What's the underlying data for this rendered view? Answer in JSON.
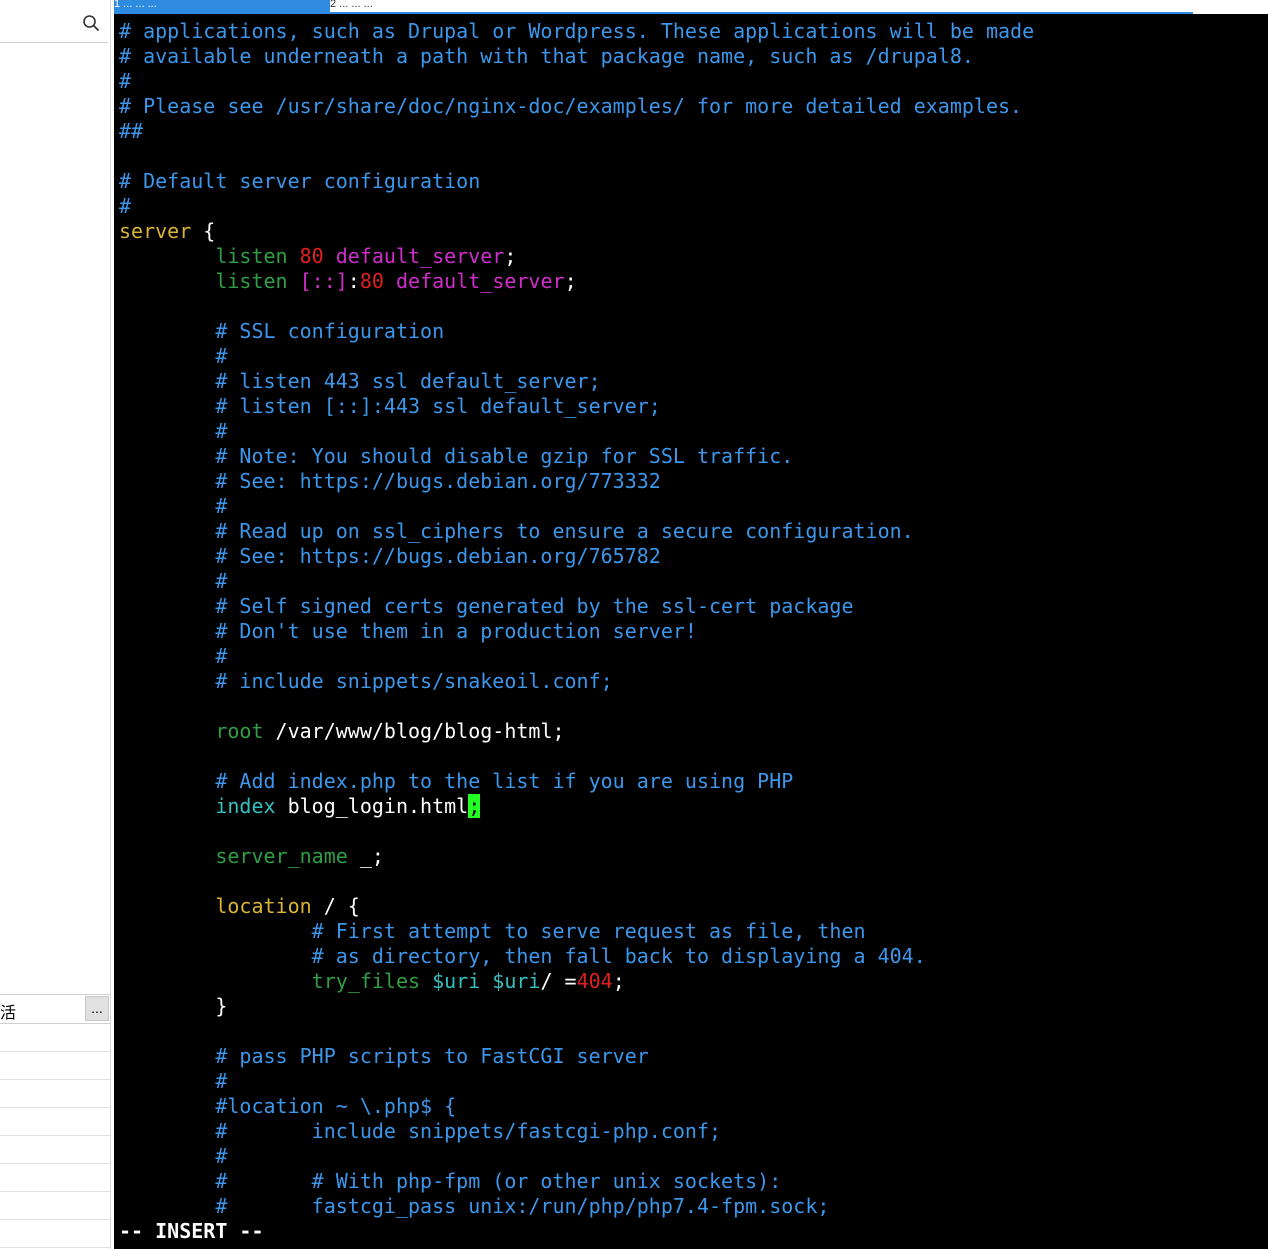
{
  "left_panel": {
    "bottom_row_label": "活",
    "more_button_label": "..."
  },
  "tabs": {
    "active": "1 ... ... ...",
    "inactive": "2 ... ... ..."
  },
  "editor": {
    "lines": [
      [
        {
          "t": "# applications, such as Drupal or Wordpress. These applications will be made",
          "c": "c"
        }
      ],
      [
        {
          "t": "# available underneath a path with that package name, such as /drupal8.",
          "c": "c"
        }
      ],
      [
        {
          "t": "#",
          "c": "c"
        }
      ],
      [
        {
          "t": "# Please see /usr/share/doc/nginx-doc/examples/ for more detailed examples.",
          "c": "c"
        }
      ],
      [
        {
          "t": "##",
          "c": "c"
        }
      ],
      [],
      [
        {
          "t": "# Default server configuration",
          "c": "c"
        }
      ],
      [
        {
          "t": "#",
          "c": "c"
        }
      ],
      [
        {
          "t": "server",
          "c": "kw"
        },
        {
          "t": " {",
          "c": "wt"
        }
      ],
      [
        {
          "t": "        ",
          "c": "wt"
        },
        {
          "t": "listen",
          "c": "dir"
        },
        {
          "t": " ",
          "c": "wt"
        },
        {
          "t": "80",
          "c": "num"
        },
        {
          "t": " ",
          "c": "wt"
        },
        {
          "t": "default_server",
          "c": "mg"
        },
        {
          "t": ";",
          "c": "wt"
        }
      ],
      [
        {
          "t": "        ",
          "c": "wt"
        },
        {
          "t": "listen",
          "c": "dir"
        },
        {
          "t": " ",
          "c": "wt"
        },
        {
          "t": "[::]",
          "c": "mg"
        },
        {
          "t": ":",
          "c": "wt"
        },
        {
          "t": "80",
          "c": "num"
        },
        {
          "t": " ",
          "c": "wt"
        },
        {
          "t": "default_server",
          "c": "mg"
        },
        {
          "t": ";",
          "c": "wt"
        }
      ],
      [],
      [
        {
          "t": "        ",
          "c": "wt"
        },
        {
          "t": "# SSL configuration",
          "c": "c"
        }
      ],
      [
        {
          "t": "        ",
          "c": "wt"
        },
        {
          "t": "#",
          "c": "c"
        }
      ],
      [
        {
          "t": "        ",
          "c": "wt"
        },
        {
          "t": "# listen 443 ssl default_server;",
          "c": "c"
        }
      ],
      [
        {
          "t": "        ",
          "c": "wt"
        },
        {
          "t": "# listen [::]:443 ssl default_server;",
          "c": "c"
        }
      ],
      [
        {
          "t": "        ",
          "c": "wt"
        },
        {
          "t": "#",
          "c": "c"
        }
      ],
      [
        {
          "t": "        ",
          "c": "wt"
        },
        {
          "t": "# Note: You should disable gzip for SSL traffic.",
          "c": "c"
        }
      ],
      [
        {
          "t": "        ",
          "c": "wt"
        },
        {
          "t": "# See: https://bugs.debian.org/773332",
          "c": "c"
        }
      ],
      [
        {
          "t": "        ",
          "c": "wt"
        },
        {
          "t": "#",
          "c": "c"
        }
      ],
      [
        {
          "t": "        ",
          "c": "wt"
        },
        {
          "t": "# Read up on ssl_ciphers to ensure a secure configuration.",
          "c": "c"
        }
      ],
      [
        {
          "t": "        ",
          "c": "wt"
        },
        {
          "t": "# See: https://bugs.debian.org/765782",
          "c": "c"
        }
      ],
      [
        {
          "t": "        ",
          "c": "wt"
        },
        {
          "t": "#",
          "c": "c"
        }
      ],
      [
        {
          "t": "        ",
          "c": "wt"
        },
        {
          "t": "# Self signed certs generated by the ssl-cert package",
          "c": "c"
        }
      ],
      [
        {
          "t": "        ",
          "c": "wt"
        },
        {
          "t": "# Don't use them in a production server!",
          "c": "c"
        }
      ],
      [
        {
          "t": "        ",
          "c": "wt"
        },
        {
          "t": "#",
          "c": "c"
        }
      ],
      [
        {
          "t": "        ",
          "c": "wt"
        },
        {
          "t": "# include snippets/snakeoil.conf;",
          "c": "c"
        }
      ],
      [],
      [
        {
          "t": "        ",
          "c": "wt"
        },
        {
          "t": "root",
          "c": "dir"
        },
        {
          "t": " /var/www/blog/blog-html;",
          "c": "wt"
        }
      ],
      [],
      [
        {
          "t": "        ",
          "c": "wt"
        },
        {
          "t": "# Add index.php to the list if you are using PHP",
          "c": "c"
        }
      ],
      [
        {
          "t": "        ",
          "c": "wt"
        },
        {
          "t": "index",
          "c": "cy"
        },
        {
          "t": " blog_login.html",
          "c": "wt"
        },
        {
          "t": ";",
          "c": "cursor"
        }
      ],
      [],
      [
        {
          "t": "        ",
          "c": "wt"
        },
        {
          "t": "server_name",
          "c": "dir"
        },
        {
          "t": " _;",
          "c": "wt"
        }
      ],
      [],
      [
        {
          "t": "        ",
          "c": "wt"
        },
        {
          "t": "location",
          "c": "kw"
        },
        {
          "t": " / {",
          "c": "wt"
        }
      ],
      [
        {
          "t": "                ",
          "c": "wt"
        },
        {
          "t": "# First attempt to serve request as file, then",
          "c": "c"
        }
      ],
      [
        {
          "t": "                ",
          "c": "wt"
        },
        {
          "t": "# as directory, then fall back to displaying a 404.",
          "c": "c"
        }
      ],
      [
        {
          "t": "                ",
          "c": "wt"
        },
        {
          "t": "try_files",
          "c": "dir"
        },
        {
          "t": " ",
          "c": "wt"
        },
        {
          "t": "$uri",
          "c": "cy"
        },
        {
          "t": " ",
          "c": "wt"
        },
        {
          "t": "$uri",
          "c": "cy"
        },
        {
          "t": "/ =",
          "c": "wt"
        },
        {
          "t": "404",
          "c": "num"
        },
        {
          "t": ";",
          "c": "wt"
        }
      ],
      [
        {
          "t": "        }",
          "c": "wt"
        }
      ],
      [],
      [
        {
          "t": "        ",
          "c": "wt"
        },
        {
          "t": "# pass PHP scripts to FastCGI server",
          "c": "c"
        }
      ],
      [
        {
          "t": "        ",
          "c": "wt"
        },
        {
          "t": "#",
          "c": "c"
        }
      ],
      [
        {
          "t": "        ",
          "c": "wt"
        },
        {
          "t": "#location ~ \\.php$ {",
          "c": "c"
        }
      ],
      [
        {
          "t": "        ",
          "c": "wt"
        },
        {
          "t": "#       include snippets/fastcgi-php.conf;",
          "c": "c"
        }
      ],
      [
        {
          "t": "        ",
          "c": "wt"
        },
        {
          "t": "#",
          "c": "c"
        }
      ],
      [
        {
          "t": "        ",
          "c": "wt"
        },
        {
          "t": "#       # With php-fpm (or other unix sockets):",
          "c": "c"
        }
      ],
      [
        {
          "t": "        ",
          "c": "wt"
        },
        {
          "t": "#       fastcgi_pass unix:/run/php/php7.4-fpm.sock;",
          "c": "c"
        }
      ]
    ],
    "mode_indicator": "-- INSERT --"
  },
  "colors": {
    "comment": "#3c96ea",
    "keyword": "#d9b431",
    "directive": "#2f9e44",
    "number": "#e02020",
    "parameter": "#d02ecb",
    "variable": "#35c0c0",
    "cursor": "#22ff22",
    "tab_accent": "#2f8be0"
  }
}
